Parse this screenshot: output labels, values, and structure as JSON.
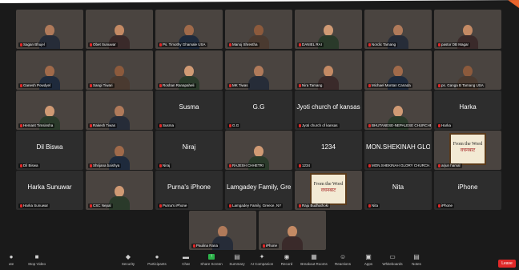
{
  "window": {
    "accent": "#e8642c"
  },
  "participants": [
    {
      "label": "Sagan Bhujel",
      "display": "",
      "video": true
    },
    {
      "label": "Obet Sunuwar",
      "display": "",
      "video": true
    },
    {
      "label": "Ps. Timothy Ghamale USA",
      "display": "",
      "video": true
    },
    {
      "label": "Manoj Shrestha",
      "display": "",
      "video": true
    },
    {
      "label": "DANIEL RAI",
      "display": "",
      "video": true
    },
    {
      "label": "Nordic Tamang",
      "display": "",
      "video": true
    },
    {
      "label": "pastor DB Magar",
      "display": "",
      "video": true
    },
    {
      "label": "Ganesh Powdyel",
      "display": "",
      "video": true
    },
    {
      "label": "Sangi Tiwari",
      "display": "",
      "video": true
    },
    {
      "label": "Roshan Ranapaheli",
      "display": "",
      "video": true
    },
    {
      "label": "MK Tiwas",
      "display": "",
      "video": true
    },
    {
      "label": "Nira Tamang",
      "display": "",
      "video": true
    },
    {
      "label": "Michael Montan Canada",
      "display": "",
      "video": true
    },
    {
      "label": "ps. Ganga B Tamang USA",
      "display": "",
      "video": true
    },
    {
      "label": "Hemant Timsinsha",
      "display": "",
      "video": true
    },
    {
      "label": "Rakesh Tiwas",
      "display": "",
      "video": true
    },
    {
      "label": "Susma",
      "display": "Susma",
      "video": false
    },
    {
      "label": "G.G",
      "display": "G.G",
      "video": false
    },
    {
      "label": "Jyoti church of kansas",
      "display": "Jyoti church of kansas",
      "video": false
    },
    {
      "label": "BHUTANESE-NEPALESE CHURCHE...",
      "display": "",
      "video": true
    },
    {
      "label": "Harka",
      "display": "Harka",
      "video": false
    },
    {
      "label": "Dil Biswa",
      "display": "Dil Biswa",
      "video": false
    },
    {
      "label": "Shrijana baishya",
      "display": "",
      "video": true
    },
    {
      "label": "Niraj",
      "display": "Niraj",
      "video": false
    },
    {
      "label": "RAJESH CHHETRI",
      "display": "",
      "video": true
    },
    {
      "label": "1234",
      "display": "1234",
      "video": false
    },
    {
      "label": "MON.SHEKINAH GLORY CHURCH...",
      "display": "MON.SHEKINAH GLO...",
      "video": false
    },
    {
      "label": "arjun hamal",
      "display": "",
      "video": true,
      "book": true
    },
    {
      "label": "Harka Sunuwar",
      "display": "Harka Sunuwar",
      "video": false
    },
    {
      "label": "CSC Nepal",
      "display": "",
      "video": true
    },
    {
      "label": "Purna's iPhone",
      "display": "Purna's iPhone",
      "video": false
    },
    {
      "label": "Lamgadey Family, Greece, NY",
      "display": "Lamgadey Family, Gre...",
      "video": false
    },
    {
      "label": "Raju Budhathoki",
      "display": "",
      "video": true,
      "book": true
    },
    {
      "label": "Nita",
      "display": "Nita",
      "video": false
    },
    {
      "label": "iPhone",
      "display": "iPhone",
      "video": false
    },
    {
      "label": "Paulina Rana",
      "display": "",
      "video": true
    },
    {
      "label": "iPhone",
      "display": "",
      "video": true
    }
  ],
  "book": {
    "line1": "From the Word",
    "line2": "वचनबाट"
  },
  "toolbar": {
    "items": [
      {
        "label": "ute",
        "icon": "mic-icon",
        "glyph": "●"
      },
      {
        "label": "Stop Video",
        "icon": "video-icon",
        "glyph": "■"
      },
      {
        "label": "Security",
        "icon": "shield-icon",
        "glyph": "◆"
      },
      {
        "label": "Participants",
        "icon": "participants-icon",
        "glyph": "●"
      },
      {
        "label": "Chat",
        "icon": "chat-icon",
        "glyph": "▬"
      },
      {
        "label": "Share Screen",
        "icon": "share-screen-icon",
        "glyph": "↑"
      },
      {
        "label": "Summary",
        "icon": "summary-icon",
        "glyph": "▤"
      },
      {
        "label": "AI Companion",
        "icon": "ai-companion-icon",
        "glyph": "✦"
      },
      {
        "label": "Record",
        "icon": "record-icon",
        "glyph": "◉"
      },
      {
        "label": "Breakout Rooms",
        "icon": "breakout-rooms-icon",
        "glyph": "▦"
      },
      {
        "label": "Reactions",
        "icon": "reactions-icon",
        "glyph": "☺"
      },
      {
        "label": "Apps",
        "icon": "apps-icon",
        "glyph": "▣"
      },
      {
        "label": "Whiteboards",
        "icon": "whiteboard-icon",
        "glyph": "▭"
      },
      {
        "label": "Notes",
        "icon": "notes-icon",
        "glyph": "▤"
      }
    ],
    "leave_label": "Leave"
  }
}
